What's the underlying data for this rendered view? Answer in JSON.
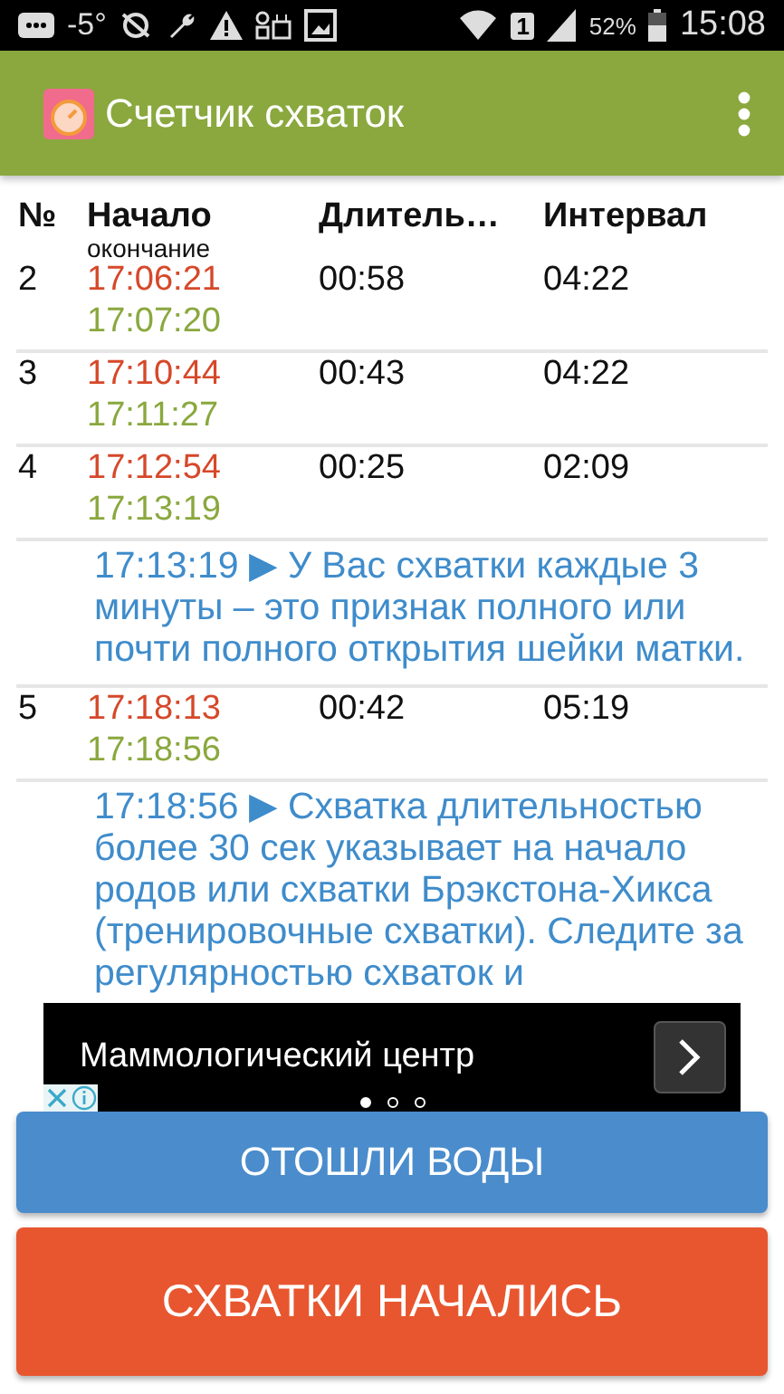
{
  "status_bar": {
    "temperature": "-5°",
    "sim": "1",
    "battery": "52%",
    "time": "15:08"
  },
  "app_bar": {
    "title": "Счетчик схваток"
  },
  "table": {
    "columns": [
      "№",
      "Начало",
      "Длитель…",
      "Интервал"
    ],
    "subheading": "окончание",
    "rows": [
      {
        "kind": "contraction",
        "number": "2",
        "start": "17:06:21",
        "end": "17:07:20",
        "duration": "00:58",
        "interval": "04:22"
      },
      {
        "kind": "contraction",
        "number": "3",
        "start": "17:10:44",
        "end": "17:11:27",
        "duration": "00:43",
        "interval": "04:22"
      },
      {
        "kind": "contraction",
        "number": "4",
        "start": "17:12:54",
        "end": "17:13:19",
        "duration": "00:25",
        "interval": "02:09"
      },
      {
        "kind": "note",
        "text": "17:13:19 ▶ У Вас схватки каждые 3 минуты – это признак полного или почти полного открытия шейки матки."
      },
      {
        "kind": "contraction",
        "number": "5",
        "start": "17:18:13",
        "end": "17:18:56",
        "duration": "00:42",
        "interval": "05:19"
      },
      {
        "kind": "note",
        "text": "17:18:56 ▶ Схватка длительностью более 30 сек указывает на начало родов или схватки Брэкстона-Хикса (тренировочные схватки). Следите за регулярностью схваток и"
      }
    ]
  },
  "ad": {
    "text": "Маммологический центр",
    "pages": [
      {
        "selected": true
      },
      {
        "selected": false
      },
      {
        "selected": false
      }
    ]
  },
  "buttons": [
    {
      "kind": "secondary",
      "label": "ОТОШЛИ ВОДЫ"
    },
    {
      "kind": "primary",
      "label": "СХВАТКИ НАЧАЛИСЬ"
    }
  ]
}
